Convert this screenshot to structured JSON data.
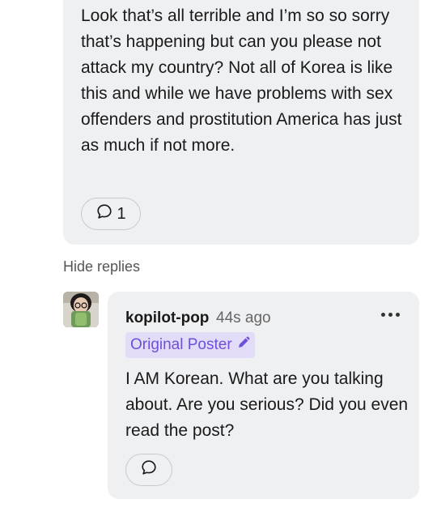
{
  "parent_comment": {
    "text": "Look that’s all terrible and I’m so so sorry that’s happening but can you please not attack my country? Not all of Korea is like this and while we have problems with sex offenders and prostitution America has just as much if not more.",
    "reply_count": "1",
    "reply_icon": "speech-bubble-icon"
  },
  "replies_toggle": {
    "label": "Hide replies"
  },
  "reply": {
    "username": "kopilot-pop",
    "timestamp": "44s ago",
    "badge_label": "Original Poster",
    "badge_icon": "pencil-icon",
    "text": "I AM Korean. What are you talking about. Are you serious? Did you even read the post?",
    "more_icon": "more-dots-icon",
    "reply_icon": "speech-bubble-icon"
  },
  "colors": {
    "card_bg": "#eff0f2",
    "badge_bg": "#e2dcf9",
    "badge_text": "#6f4fd9",
    "muted_text": "#666666"
  }
}
